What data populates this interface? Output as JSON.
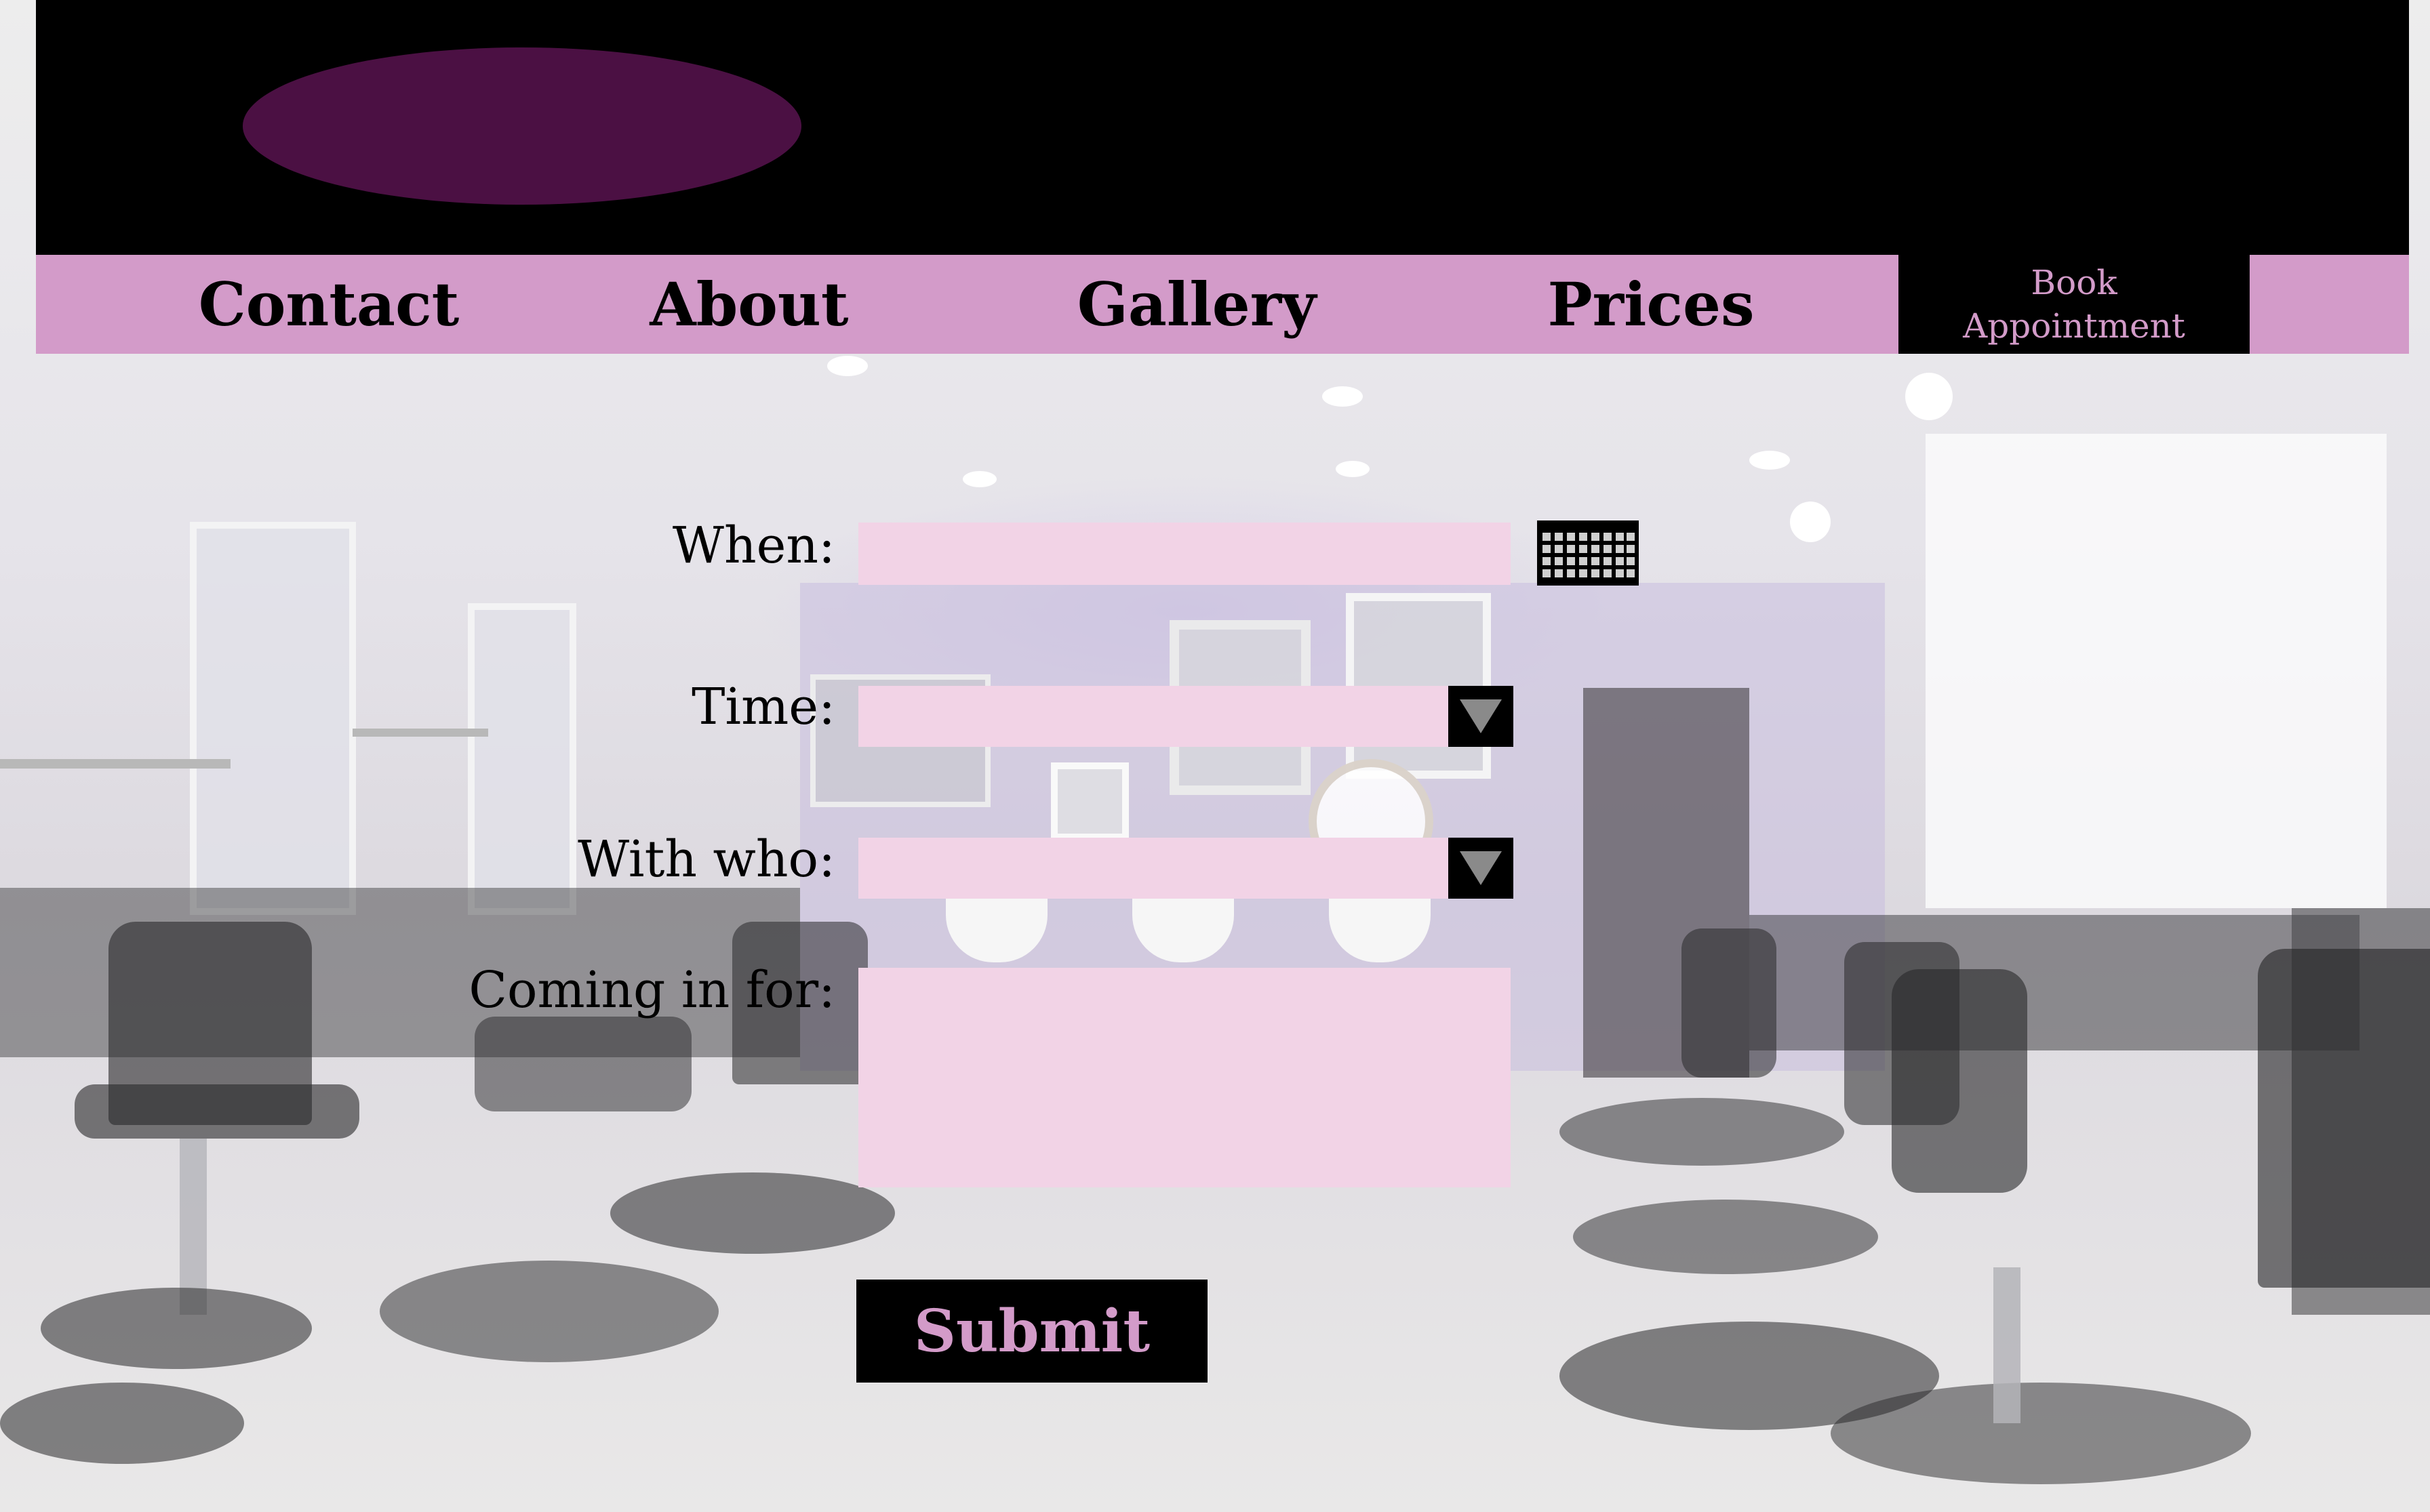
{
  "nav": {
    "contact": "Contact",
    "about": "About",
    "gallery": "Gallery",
    "prices": "Prices",
    "book_line1": "Book",
    "book_line2": "Appointment"
  },
  "form": {
    "when_label": "When:",
    "when_value": "",
    "time_label": "Time:",
    "time_value": "",
    "with_label": "With who:",
    "with_value": "",
    "coming_label": "Coming in for:",
    "coming_value": "",
    "submit_label": "Submit"
  },
  "colors": {
    "header_bg": "#000000",
    "logo": "#4b1043",
    "nav_bg": "#d39bc9",
    "field_bg": "#f2d3e6",
    "accent_text": "#d39bc9"
  },
  "icons": {
    "calendar": "calendar-icon",
    "dropdown": "triangle-down-icon"
  }
}
